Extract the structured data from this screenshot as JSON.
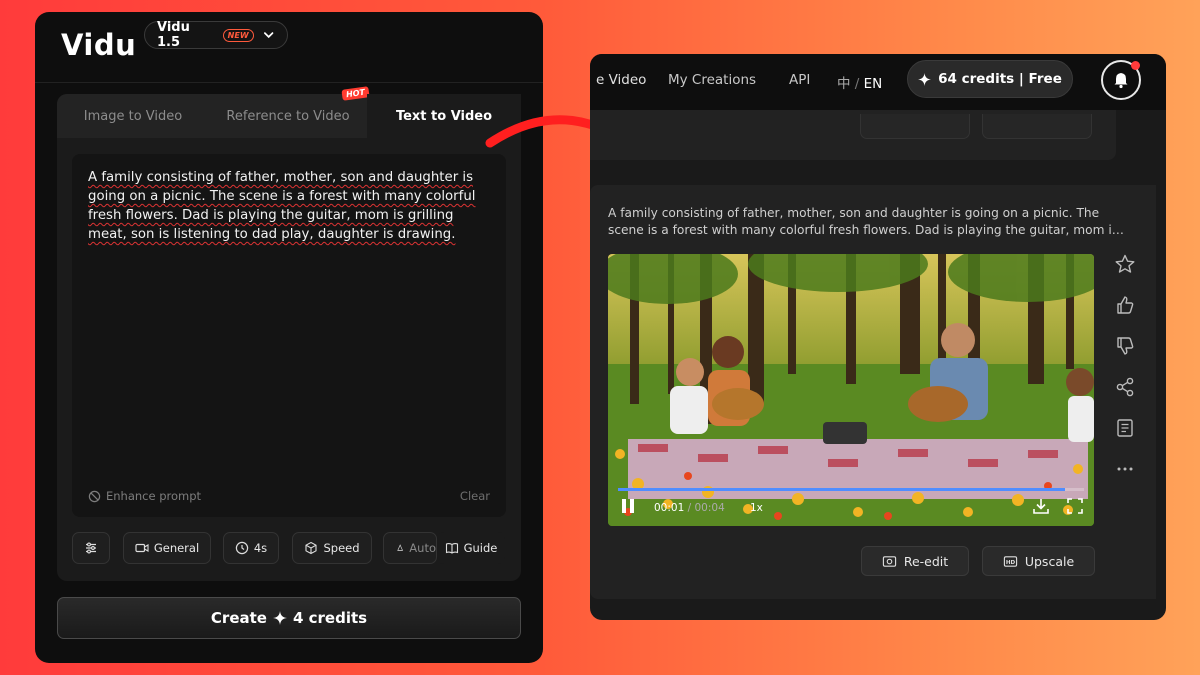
{
  "left": {
    "logo": "Vidu",
    "version": {
      "label": "Vidu 1.5",
      "badge": "NEW"
    },
    "tabs": [
      {
        "label": "Image to Video"
      },
      {
        "label": "Reference to Video",
        "badge": "HOT"
      },
      {
        "label": "Text to Video",
        "active": true
      }
    ],
    "prompt": "A family consisting of father, mother, son and daughter is going on a picnic. The scene is a forest with many colorful fresh flowers. Dad is playing the guitar, mom is grilling meat, son is listening to dad play, daughter is drawing.",
    "enhance_label": "Enhance prompt",
    "clear_label": "Clear",
    "toolbar": {
      "general": "General",
      "duration": "4s",
      "speed": "Speed",
      "auto": "Auto",
      "guide": "Guide"
    },
    "create_button": {
      "label": "Create",
      "credits": "4 credits"
    }
  },
  "right": {
    "nav": {
      "partial_item": "e Video",
      "my_creations": "My Creations",
      "api": "API",
      "lang_zh": "中",
      "lang_sep": "/",
      "lang_en": "EN",
      "credits": "64 credits | Free"
    },
    "generation": {
      "prompt": "A family consisting of father, mother, son and daughter is going on a picnic. The scene is a forest with many colorful fresh flowers. Dad is playing the guitar, mom is grilling meat, son is listening to dad play, daughter is drawing.",
      "video": {
        "current_time": "00:01",
        "separator": "/",
        "duration": "00:04",
        "speed": "1x",
        "progress": 0.96
      },
      "side_actions": [
        "star-icon",
        "thumbs-up-icon",
        "thumbs-down-icon",
        "share-icon",
        "document-icon",
        "more-icon"
      ],
      "buttons": {
        "reedit": "Re-edit",
        "upscale": "Upscale"
      }
    }
  },
  "colors": {
    "accent_blue": "#4f8dff",
    "hot_red": "#ff3b30",
    "new_orange": "#ff5a3c"
  }
}
